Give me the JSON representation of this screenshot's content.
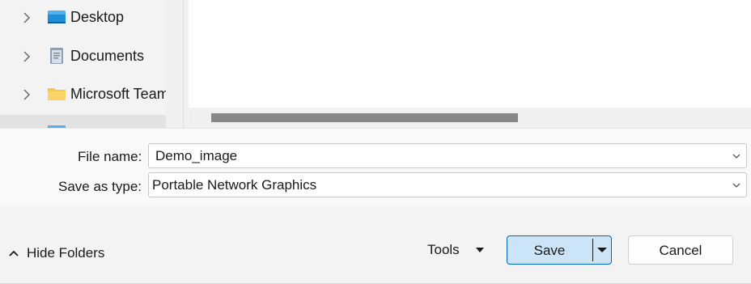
{
  "navigation": {
    "items": [
      {
        "label": "Desktop",
        "icon": "desktop-folder-icon"
      },
      {
        "label": "Documents",
        "icon": "documents-folder-icon"
      },
      {
        "label": "Microsoft Teams",
        "icon": "folder-icon"
      }
    ]
  },
  "form": {
    "file_name_label": "File name:",
    "file_name_value": "Demo_image",
    "save_type_label": "Save as type:",
    "save_type_value": "Portable Network Graphics"
  },
  "footer": {
    "hide_folders_label": "Hide Folders",
    "tools_label": "Tools",
    "save_label": "Save",
    "cancel_label": "Cancel"
  },
  "colors": {
    "accent": "#0067c0",
    "save_bg": "#cce4f7"
  }
}
